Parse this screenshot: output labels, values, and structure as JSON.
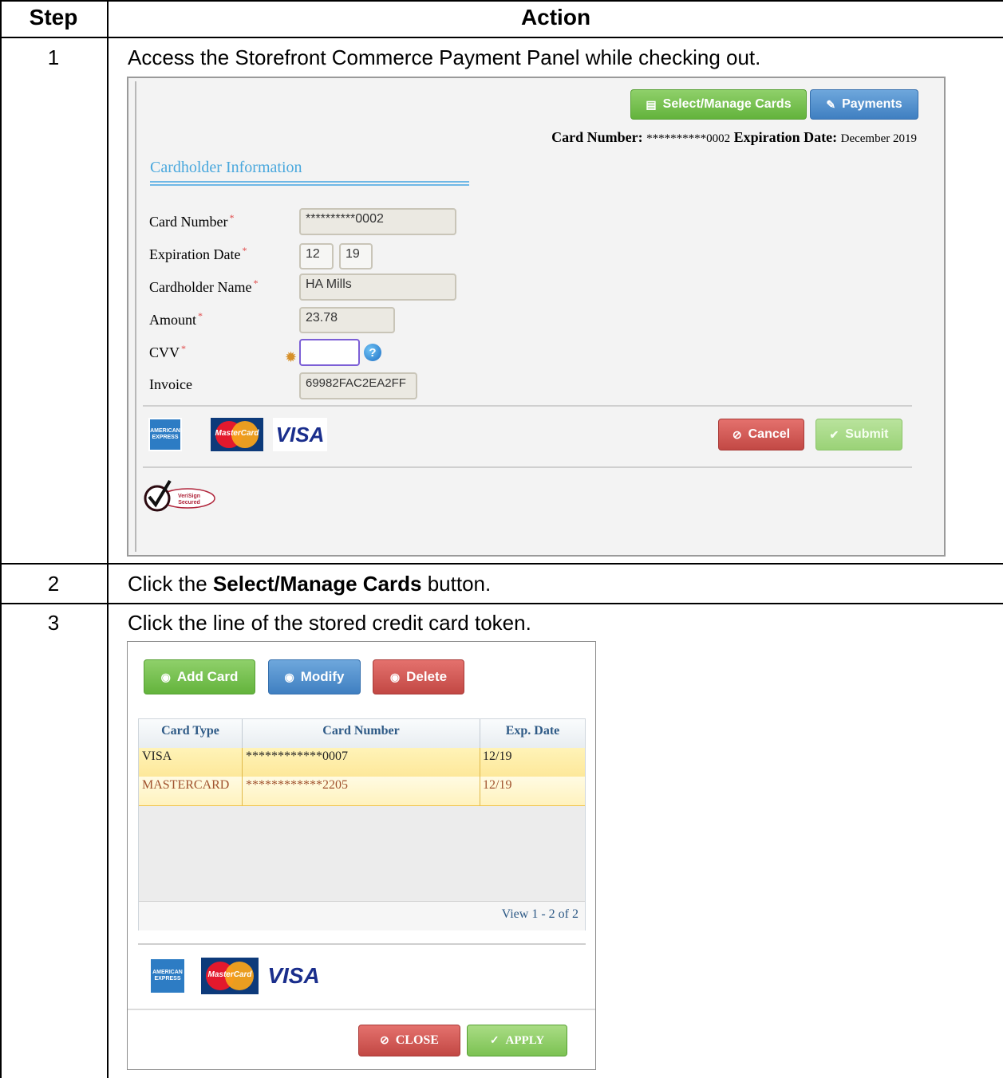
{
  "table": {
    "headers": {
      "step": "Step",
      "action": "Action"
    },
    "rows": [
      {
        "step": "1",
        "action": "Access the Storefront Commerce Payment Panel while checking out."
      },
      {
        "step": "2",
        "action_prefix": "Click the ",
        "action_bold": "Select/Manage Cards",
        "action_suffix": " button."
      },
      {
        "step": "3",
        "action": "Click the line of the stored credit card token."
      }
    ]
  },
  "payment_panel": {
    "buttons": {
      "select_manage": "Select/Manage Cards",
      "payments": "Payments",
      "cancel": "Cancel",
      "submit": "Submit"
    },
    "card_summary": {
      "card_number_label": "Card Number:",
      "card_number_value": "**********0002",
      "expiration_label": "Expiration Date:",
      "expiration_value": "December 2019"
    },
    "section_title": "Cardholder Information",
    "fields": {
      "card_number": {
        "label": "Card Number",
        "value": "**********0002"
      },
      "expiration_date": {
        "label": "Expiration Date",
        "month": "12",
        "year": "19"
      },
      "cardholder_name": {
        "label": "Cardholder Name",
        "value": "HA Mills"
      },
      "amount": {
        "label": "Amount",
        "value": "23.78"
      },
      "cvv": {
        "label": "CVV",
        "value": ""
      },
      "invoice": {
        "label": "Invoice",
        "value": "69982FAC2EA2FF"
      }
    },
    "required_mark": "*",
    "help_icon_glyph": "?",
    "logos": {
      "amex": "AMERICAN EXPRESS",
      "mastercard": "MasterCard",
      "visa": "VISA",
      "verisign": "VeriSign Secured"
    }
  },
  "manage_cards_dialog": {
    "buttons": {
      "add": "Add Card",
      "modify": "Modify",
      "delete": "Delete",
      "close": "CLOSE",
      "apply": "APPLY"
    },
    "grid": {
      "columns": [
        "Card Type",
        "Card Number",
        "Exp. Date"
      ],
      "rows": [
        {
          "type": "VISA",
          "number": "************0007",
          "exp": "12/19"
        },
        {
          "type": "MASTERCARD",
          "number": "************2205",
          "exp": "12/19"
        }
      ],
      "pager": "View 1 - 2 of 2"
    },
    "logos": {
      "amex": "AMERICAN EXPRESS",
      "mastercard": "MasterCard",
      "visa": "VISA"
    }
  },
  "colors": {
    "green_button": "#63b33c",
    "blue_button": "#3f7fc1",
    "red_button": "#c24844",
    "section_blue": "#4aa8dd",
    "row_highlight": "#fde89a"
  }
}
